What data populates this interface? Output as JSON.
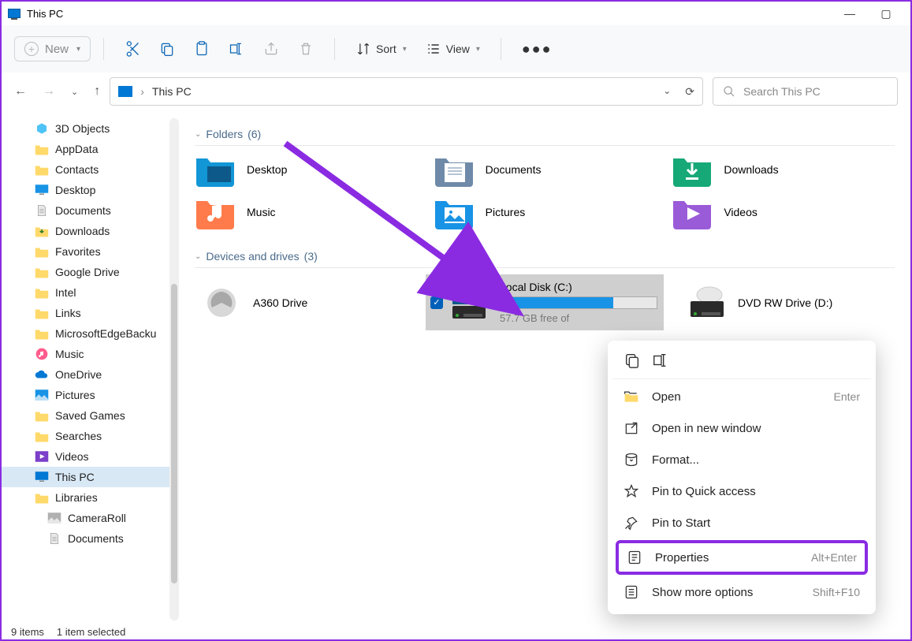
{
  "window": {
    "title": "This PC"
  },
  "toolbar": {
    "new": "New",
    "sort": "Sort",
    "view": "View"
  },
  "address": {
    "location": "This PC"
  },
  "search": {
    "placeholder": "Search This PC"
  },
  "sidebar": [
    {
      "label": "3D Objects",
      "icon": "cube",
      "color": "#4fc3f7"
    },
    {
      "label": "AppData",
      "icon": "folder",
      "color": "#ffd96a"
    },
    {
      "label": "Contacts",
      "icon": "folder",
      "color": "#ffd96a"
    },
    {
      "label": "Desktop",
      "icon": "desktop",
      "color": "#1893e5"
    },
    {
      "label": "Documents",
      "icon": "doc",
      "color": "#b0b0b0"
    },
    {
      "label": "Downloads",
      "icon": "download",
      "color": "#ffd96a"
    },
    {
      "label": "Favorites",
      "icon": "folder",
      "color": "#ffd96a"
    },
    {
      "label": "Google Drive",
      "icon": "folder",
      "color": "#ffd96a"
    },
    {
      "label": "Intel",
      "icon": "folder",
      "color": "#ffd96a"
    },
    {
      "label": "Links",
      "icon": "folder",
      "color": "#ffd96a"
    },
    {
      "label": "MicrosoftEdgeBacku",
      "icon": "folder",
      "color": "#ffd96a"
    },
    {
      "label": "Music",
      "icon": "music",
      "color": "#ff5b8c"
    },
    {
      "label": "OneDrive",
      "icon": "cloud",
      "color": "#0078d4"
    },
    {
      "label": "Pictures",
      "icon": "pic",
      "color": "#1893e5"
    },
    {
      "label": "Saved Games",
      "icon": "folder",
      "color": "#ffd96a"
    },
    {
      "label": "Searches",
      "icon": "folder",
      "color": "#ffd96a"
    },
    {
      "label": "Videos",
      "icon": "video",
      "color": "#7b3fc9"
    },
    {
      "label": "This PC",
      "icon": "pc",
      "color": "#0078d4",
      "active": true
    },
    {
      "label": "Libraries",
      "icon": "folder",
      "color": "#ffd96a"
    },
    {
      "label": "CameraRoll",
      "icon": "pic",
      "color": "#b0b0b0",
      "indent": true
    },
    {
      "label": "Documents",
      "icon": "doc",
      "color": "#b0b0b0",
      "indent": true
    }
  ],
  "groups": {
    "folders": {
      "title": "Folders",
      "count": "(6)"
    },
    "drives": {
      "title": "Devices and drives",
      "count": "(3)"
    }
  },
  "folders": [
    {
      "label": "Desktop",
      "color": "#1296d6"
    },
    {
      "label": "Documents",
      "color": "#6e8aa8"
    },
    {
      "label": "Downloads",
      "color": "#17a878"
    },
    {
      "label": "Music",
      "color": "#ff7b4b"
    },
    {
      "label": "Pictures",
      "color": "#1893e5"
    },
    {
      "label": "Videos",
      "color": "#9a5bd8"
    }
  ],
  "drives": [
    {
      "label": "A360 Drive",
      "type": "cloud"
    },
    {
      "label": "Local Disk (C:)",
      "type": "hdd",
      "selected": true,
      "free": "57.7 GB free of",
      "fillPct": 72
    },
    {
      "label": "DVD RW Drive (D:)",
      "type": "dvd"
    }
  ],
  "context_menu": {
    "items": [
      {
        "label": "Open",
        "shortcut": "Enter",
        "icon": "open"
      },
      {
        "label": "Open in new window",
        "shortcut": "",
        "icon": "newwin"
      },
      {
        "label": "Format...",
        "shortcut": "",
        "icon": "format"
      },
      {
        "label": "Pin to Quick access",
        "shortcut": "",
        "icon": "star"
      },
      {
        "label": "Pin to Start",
        "shortcut": "",
        "icon": "pin"
      },
      {
        "label": "Properties",
        "shortcut": "Alt+Enter",
        "icon": "props",
        "highlight": true
      },
      {
        "label": "Show more options",
        "shortcut": "Shift+F10",
        "icon": "more"
      }
    ]
  },
  "status": {
    "items": "9 items",
    "selected": "1 item selected"
  }
}
